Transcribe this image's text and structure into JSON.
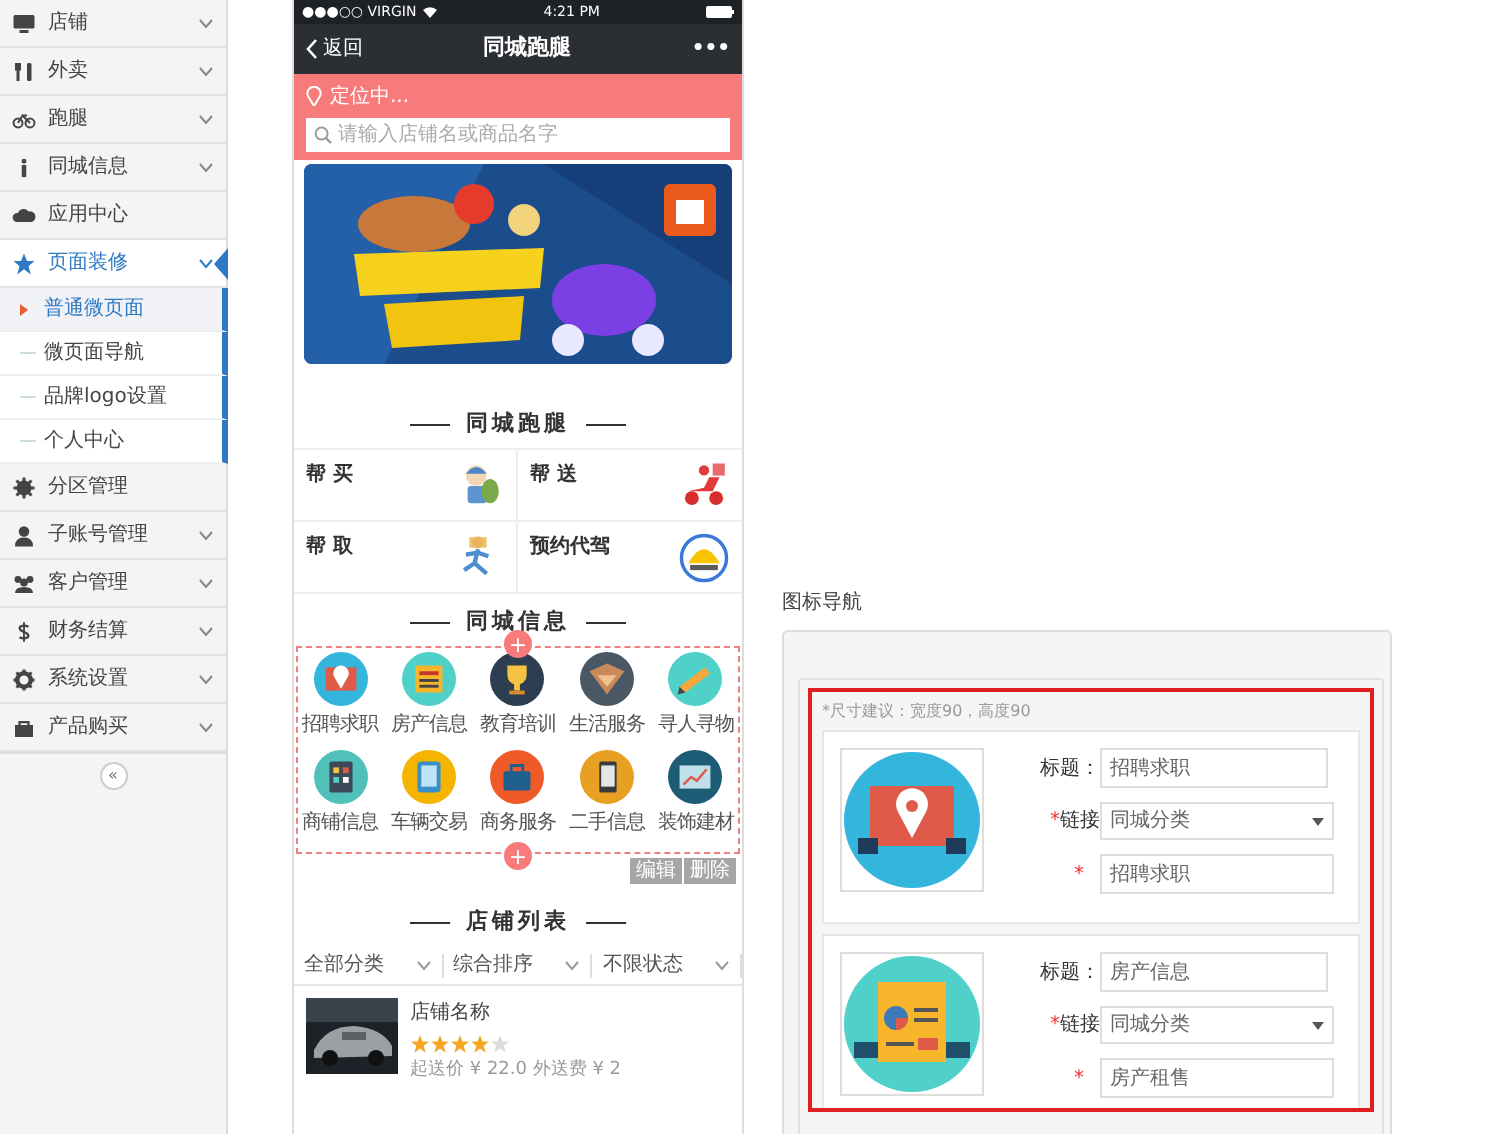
{
  "sidebar": {
    "items": [
      {
        "label": "店铺",
        "kind": "group",
        "expanded": false,
        "selected": false
      },
      {
        "label": "外卖",
        "kind": "group",
        "expanded": false,
        "selected": false
      },
      {
        "label": "跑腿",
        "kind": "group",
        "expanded": false,
        "selected": false
      },
      {
        "label": "同城信息",
        "kind": "group",
        "expanded": false,
        "selected": false
      },
      {
        "label": "应用中心",
        "kind": "link",
        "selected": false
      },
      {
        "label": "页面装修",
        "kind": "group",
        "expanded": true,
        "selected": true,
        "children": [
          {
            "label": "普通微页面",
            "selected": true
          },
          {
            "label": "微页面导航",
            "selected": false
          },
          {
            "label": "品牌logo设置",
            "selected": false
          },
          {
            "label": "个人中心",
            "selected": false
          }
        ]
      },
      {
        "label": "分区管理",
        "kind": "link",
        "selected": false
      },
      {
        "label": "子账号管理",
        "kind": "group",
        "expanded": false,
        "selected": false
      },
      {
        "label": "客户管理",
        "kind": "group",
        "expanded": false,
        "selected": false
      },
      {
        "label": "财务结算",
        "kind": "group",
        "expanded": false,
        "selected": false
      },
      {
        "label": "系统设置",
        "kind": "group",
        "expanded": false,
        "selected": false
      },
      {
        "label": "产品购买",
        "kind": "group",
        "expanded": false,
        "selected": false
      }
    ],
    "collapse_button": "«"
  },
  "phone": {
    "status_bar": {
      "carrier": "●●●○○ VIRGIN",
      "time": "4:21 PM"
    },
    "nav": {
      "back": "返回",
      "title": "同城跑腿",
      "more": "•••"
    },
    "location": "定位中...",
    "search": {
      "placeholder": "请输入店铺名或商品名字"
    },
    "errand": {
      "title": "同城跑腿",
      "items": [
        {
          "label": "帮 买"
        },
        {
          "label": "帮 送"
        },
        {
          "label": "帮 取"
        },
        {
          "label": "预约代驾"
        }
      ]
    },
    "info": {
      "title": "同城信息",
      "add_top": "+",
      "add_bottom": "+",
      "edit_button": "编辑",
      "delete_button": "删除",
      "items": [
        {
          "label": "招聘求职",
          "color": "#33b5dc"
        },
        {
          "label": "房产信息",
          "color": "#4fd0c8"
        },
        {
          "label": "教育培训",
          "color": "#2d3e50"
        },
        {
          "label": "生活服务",
          "color": "#4a5866"
        },
        {
          "label": "寻人寻物",
          "color": "#4fd0c8"
        },
        {
          "label": "商铺信息",
          "color": "#4fc1b8"
        },
        {
          "label": "车辆交易",
          "color": "#f5b400"
        },
        {
          "label": "商务服务",
          "color": "#f05a28"
        },
        {
          "label": "二手信息",
          "color": "#e8a023"
        },
        {
          "label": "装饰建材",
          "color": "#1d5c75"
        }
      ]
    },
    "stores": {
      "title": "店铺列表",
      "filters": [
        "全部分类",
        "综合排序",
        "不限状态"
      ],
      "items": [
        {
          "name": "店铺名称",
          "stars": 4,
          "fees": "起送价 ¥ 22.0 外送费 ¥ 2"
        }
      ]
    }
  },
  "editor": {
    "title": "图标导航",
    "hint": "*尺寸建议：宽度90，高度90",
    "entries": [
      {
        "title_label": "标题：",
        "title_value": "招聘求职",
        "link_required": "*",
        "link_label": "链接",
        "link_value": "同城分类",
        "text_required": "*",
        "text_value": "招聘求职"
      },
      {
        "title_label": "标题：",
        "title_value": "房产信息",
        "link_required": "*",
        "link_label": "链接",
        "link_value": "同城分类",
        "text_required": "*",
        "text_value": "房产租售"
      }
    ]
  }
}
